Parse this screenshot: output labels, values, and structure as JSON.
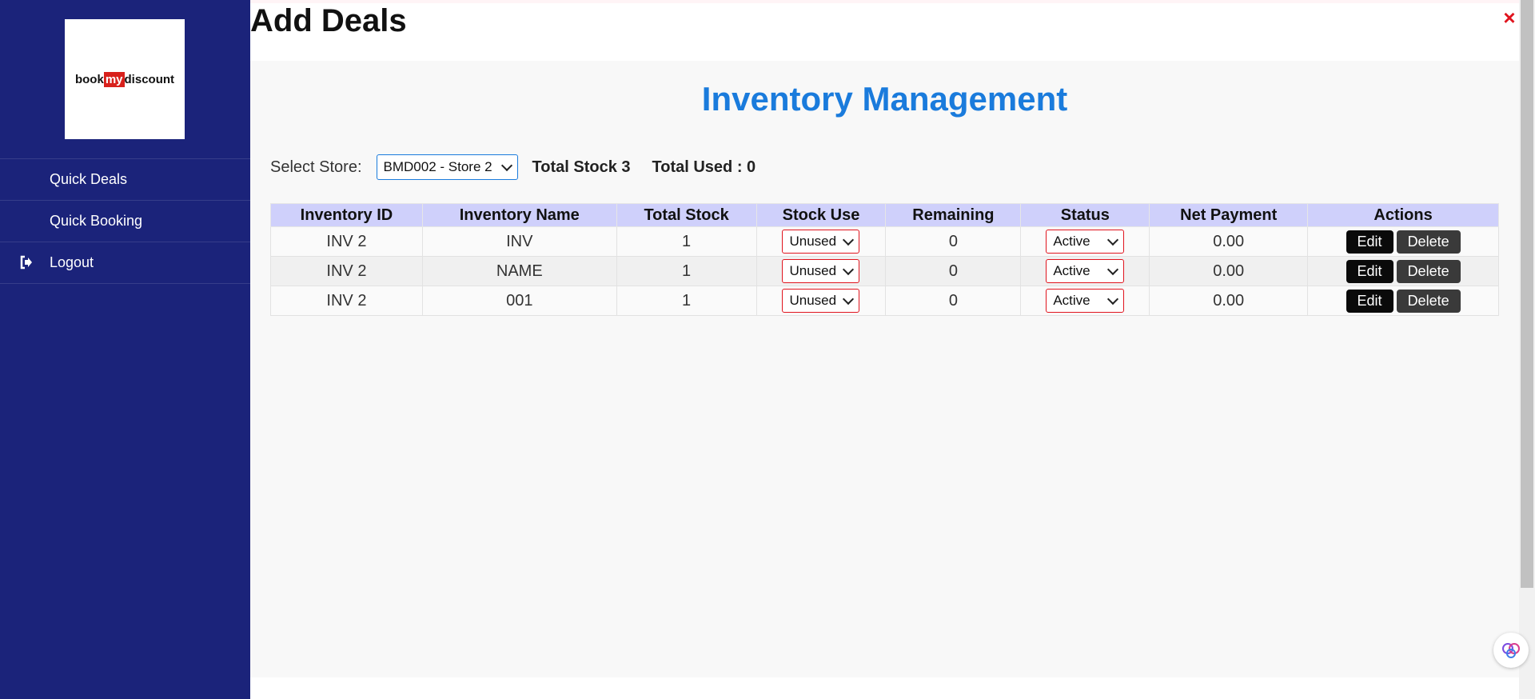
{
  "header": {
    "title": "Add Deals",
    "close_symbol": "×"
  },
  "sidebar": {
    "logo": {
      "part1": "book",
      "part2": "my",
      "part3": "discount"
    },
    "items": [
      {
        "label": "Quick Deals",
        "icon": ""
      },
      {
        "label": "Quick Booking",
        "icon": ""
      },
      {
        "label": "Logout",
        "icon": "logout-icon"
      }
    ]
  },
  "main": {
    "title": "Inventory Management",
    "store": {
      "label": "Select Store:",
      "selected": "BMD002 - Store 2",
      "total_stock": "Total Stock 3",
      "total_used": "Total Used : 0"
    },
    "table": {
      "headers": [
        "Inventory ID",
        "Inventory Name",
        "Total Stock",
        "Stock Use",
        "Remaining",
        "Status",
        "Net Payment",
        "Actions"
      ],
      "rows": [
        {
          "id": "INV 2",
          "name": "INV",
          "total": "1",
          "stock_use": "Unused",
          "remaining": "0",
          "status": "Active",
          "net": "0.00"
        },
        {
          "id": "INV 2",
          "name": "NAME",
          "total": "1",
          "stock_use": "Unused",
          "remaining": "0",
          "status": "Active",
          "net": "0.00"
        },
        {
          "id": "INV 2",
          "name": "001",
          "total": "1",
          "stock_use": "Unused",
          "remaining": "0",
          "status": "Active",
          "net": "0.00"
        }
      ],
      "edit_label": "Edit",
      "delete_label": "Delete"
    }
  },
  "colors": {
    "sidebar_bg": "#1b237a",
    "title_blue": "#1a7bdc",
    "header_row": "#cfd0fb",
    "danger": "#e0141e"
  }
}
